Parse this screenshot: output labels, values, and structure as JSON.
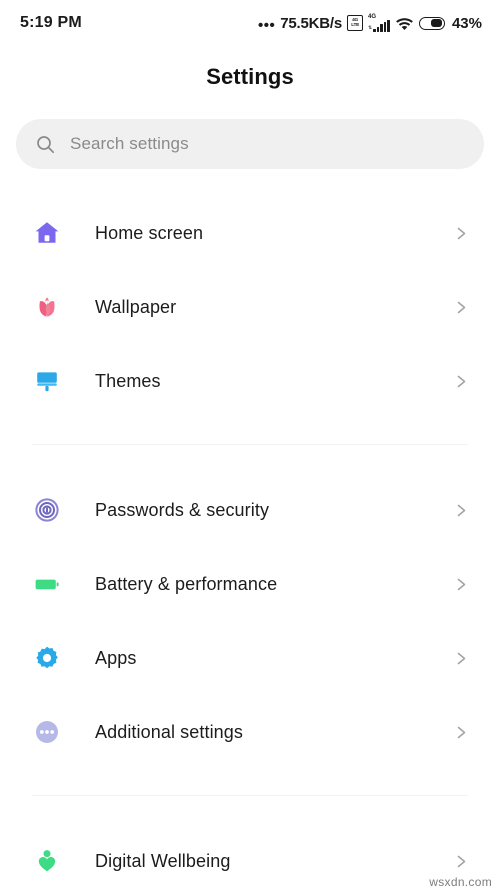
{
  "statusbar": {
    "time": "5:19 PM",
    "dots": "•••",
    "network_speed": "75.5KB/s",
    "volte_top": "4G",
    "volte_bottom": "LTE",
    "signal_label": "4G",
    "signal_arrows": "⇅",
    "battery_percent": "43%",
    "icons": [
      "volte-icon",
      "signal-bars-icon",
      "wifi-icon",
      "battery-icon"
    ]
  },
  "header": {
    "title": "Settings"
  },
  "search": {
    "placeholder": "Search settings",
    "value": "",
    "icon": "search-icon"
  },
  "groups": [
    {
      "id": "personalization",
      "items": [
        {
          "label": "Home screen",
          "icon": "home-icon",
          "color": "#7b68ee",
          "chevron": "chevron-right-icon"
        },
        {
          "label": "Wallpaper",
          "icon": "flower-icon",
          "color": "#f06292",
          "chevron": "chevron-right-icon"
        },
        {
          "label": "Themes",
          "icon": "paint-brush-icon",
          "color": "#29a8e0",
          "chevron": "chevron-right-icon"
        }
      ]
    },
    {
      "id": "system",
      "items": [
        {
          "label": "Passwords & security",
          "icon": "fingerprint-icon",
          "color": "#7b73c9",
          "chevron": "chevron-right-icon"
        },
        {
          "label": "Battery & performance",
          "icon": "battery-icon",
          "color": "#3ddc84",
          "chevron": "chevron-right-icon"
        },
        {
          "label": "Apps",
          "icon": "gear-icon",
          "color": "#28a9e8",
          "chevron": "chevron-right-icon"
        },
        {
          "label": "Additional settings",
          "icon": "more-dots-icon",
          "color": "#b6b9e8",
          "chevron": "chevron-right-icon"
        }
      ]
    },
    {
      "id": "wellbeing",
      "items": [
        {
          "label": "Digital Wellbeing",
          "icon": "person-heart-icon",
          "color": "#3ddc84",
          "chevron": "chevron-right-icon"
        }
      ]
    }
  ],
  "watermark": {
    "text": "wsxdn.com"
  },
  "colors": {
    "background": "#ffffff",
    "search_bg": "#f0f0f0",
    "divider": "#f2f2f2",
    "text_primary": "#1c1c1c",
    "text_placeholder": "#8a8a8a",
    "chevron": "#8a8a8a"
  }
}
